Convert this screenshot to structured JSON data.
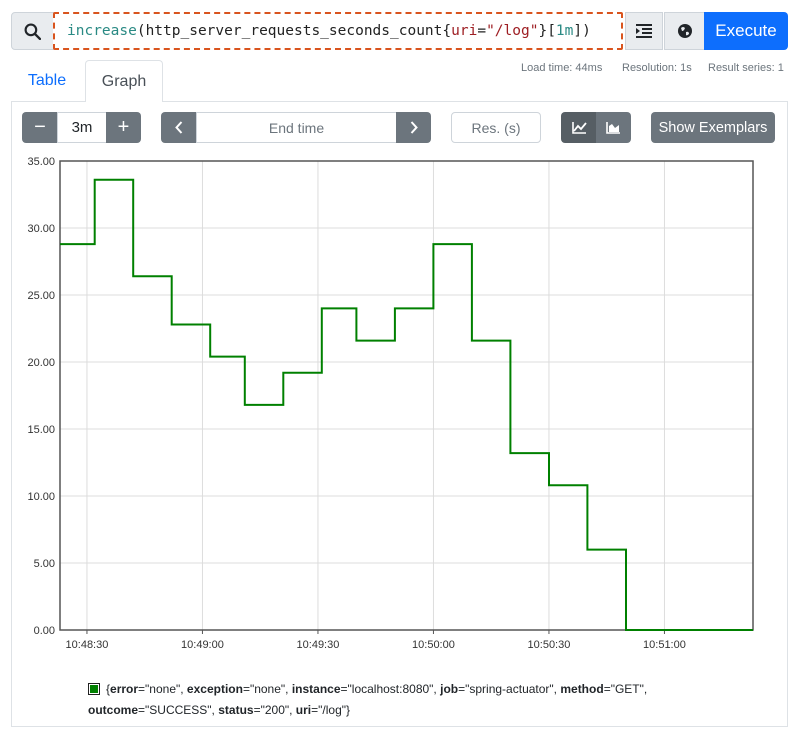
{
  "query": {
    "tokens": [
      {
        "t": "increase",
        "c": "tok-fn"
      },
      {
        "t": "(",
        "c": "tok-punct"
      },
      {
        "t": "http_server_requests_seconds_count",
        "c": "tok-metric"
      },
      {
        "t": "{",
        "c": "tok-punct"
      },
      {
        "t": "uri",
        "c": "tok-label"
      },
      {
        "t": "=",
        "c": "tok-punct"
      },
      {
        "t": "\"/log\"",
        "c": "tok-str"
      },
      {
        "t": "}",
        "c": "tok-punct"
      },
      {
        "t": "[",
        "c": "tok-punct"
      },
      {
        "t": "1m",
        "c": "tok-num"
      },
      {
        "t": "]",
        "c": "tok-punct"
      },
      {
        "t": ")",
        "c": "tok-punct"
      }
    ],
    "execute_label": "Execute",
    "icons": {
      "search": "search-icon",
      "format": "format-query-icon",
      "explorer": "metrics-explorer-icon"
    }
  },
  "stats": {
    "load_time": "Load time: 44ms",
    "resolution": "Resolution: 1s",
    "result_series": "Result series: 1"
  },
  "tabs": {
    "table": "Table",
    "graph": "Graph"
  },
  "controls": {
    "range_value": "3m",
    "minus_label": "−",
    "plus_label": "+",
    "end_time_placeholder": "End time",
    "prev_label": "‹",
    "next_label": "›",
    "res_placeholder": "Res. (s)",
    "show_exemplars": "Show Exemplars",
    "colors": {
      "accent": "#0d6efd",
      "button": "#6c757d",
      "active": "#565e64"
    }
  },
  "chart_data": {
    "type": "line",
    "step": true,
    "x_ticks": [
      "10:48:30",
      "10:49:00",
      "10:49:30",
      "10:50:00",
      "10:50:30",
      "10:51:00"
    ],
    "y_ticks": [
      "0.00",
      "5.00",
      "10.00",
      "15.00",
      "20.00",
      "25.00",
      "30.00",
      "35.00"
    ],
    "xlim": [
      "10:48:23",
      "10:51:23"
    ],
    "ylim": [
      0,
      35
    ],
    "grid": true,
    "series": [
      {
        "color": "#008000",
        "points": [
          [
            "10:48:23",
            28.8
          ],
          [
            "10:48:32",
            28.8
          ],
          [
            "10:48:32",
            33.6
          ],
          [
            "10:48:42",
            33.6
          ],
          [
            "10:48:42",
            26.4
          ],
          [
            "10:48:52",
            26.4
          ],
          [
            "10:48:52",
            22.8
          ],
          [
            "10:49:02",
            22.8
          ],
          [
            "10:49:02",
            20.4
          ],
          [
            "10:49:11",
            20.4
          ],
          [
            "10:49:11",
            16.8
          ],
          [
            "10:49:21",
            16.8
          ],
          [
            "10:49:21",
            19.2
          ],
          [
            "10:49:31",
            19.2
          ],
          [
            "10:49:31",
            24.0
          ],
          [
            "10:49:40",
            24.0
          ],
          [
            "10:49:40",
            21.6
          ],
          [
            "10:49:50",
            21.6
          ],
          [
            "10:49:50",
            24.0
          ],
          [
            "10:50:00",
            24.0
          ],
          [
            "10:50:00",
            28.8
          ],
          [
            "10:50:10",
            28.8
          ],
          [
            "10:50:10",
            21.6
          ],
          [
            "10:50:20",
            21.6
          ],
          [
            "10:50:20",
            13.2
          ],
          [
            "10:50:30",
            13.2
          ],
          [
            "10:50:30",
            10.8
          ],
          [
            "10:50:40",
            10.8
          ],
          [
            "10:50:40",
            6.0
          ],
          [
            "10:50:50",
            6.0
          ],
          [
            "10:50:50",
            0.0
          ],
          [
            "10:51:23",
            0.0
          ]
        ]
      }
    ]
  },
  "legend": {
    "open": "{",
    "labels": [
      {
        "k": "error",
        "v": "\"none\""
      },
      {
        "k": "exception",
        "v": "\"none\""
      },
      {
        "k": "instance",
        "v": "\"localhost:8080\""
      },
      {
        "k": "job",
        "v": "\"spring-actuator\""
      },
      {
        "k": "method",
        "v": "\"GET\""
      },
      {
        "k": "outcome",
        "v": "\"SUCCESS\""
      },
      {
        "k": "status",
        "v": "\"200\""
      },
      {
        "k": "uri",
        "v": "\"/log\""
      }
    ],
    "close": "}"
  }
}
